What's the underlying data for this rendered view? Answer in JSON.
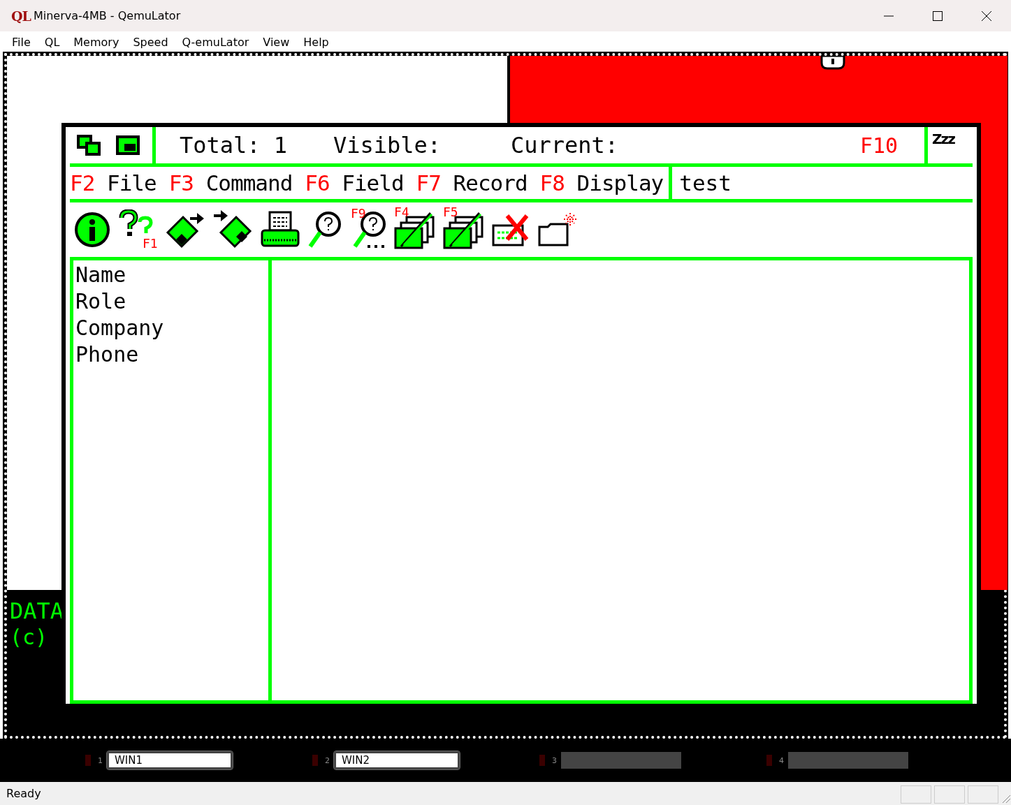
{
  "window": {
    "logo": "QL",
    "title": "Minerva-4MB - QemuLator"
  },
  "menu": [
    "File",
    "QL",
    "Memory",
    "Speed",
    "Q-emuLator",
    "View",
    "Help"
  ],
  "background_window": {
    "texts": [
      "DATA",
      "(c)"
    ]
  },
  "app": {
    "header": {
      "total": "Total: 1",
      "visible": "Visible:",
      "current": "Current:",
      "key": "F10"
    },
    "commands": [
      {
        "key": "F2",
        "label": "File"
      },
      {
        "key": "F3",
        "label": "Command"
      },
      {
        "key": "F6",
        "label": "Field"
      },
      {
        "key": "F7",
        "label": "Record"
      },
      {
        "key": "F8",
        "label": "Display"
      }
    ],
    "field_value": "test",
    "sleep_label": "Zzz",
    "toolbar": [
      {
        "kind": "info"
      },
      {
        "kind": "help",
        "key": "F1"
      },
      {
        "kind": "load"
      },
      {
        "kind": "save"
      },
      {
        "kind": "print"
      },
      {
        "kind": "search"
      },
      {
        "kind": "search_more",
        "key": "F9"
      },
      {
        "kind": "edit",
        "key": "F4"
      },
      {
        "kind": "edit_all",
        "key": "F5"
      },
      {
        "kind": "delete"
      },
      {
        "kind": "new"
      }
    ],
    "fields": [
      "Name",
      "Role",
      "Company",
      "Phone"
    ]
  },
  "taskbar": [
    {
      "kind": "window",
      "number": "1",
      "label": "WIN1"
    },
    {
      "kind": "window",
      "number": "2",
      "label": "WIN2"
    },
    {
      "kind": "empty",
      "number": "3"
    },
    {
      "kind": "empty",
      "number": "4"
    }
  ],
  "status_bar": "Ready"
}
